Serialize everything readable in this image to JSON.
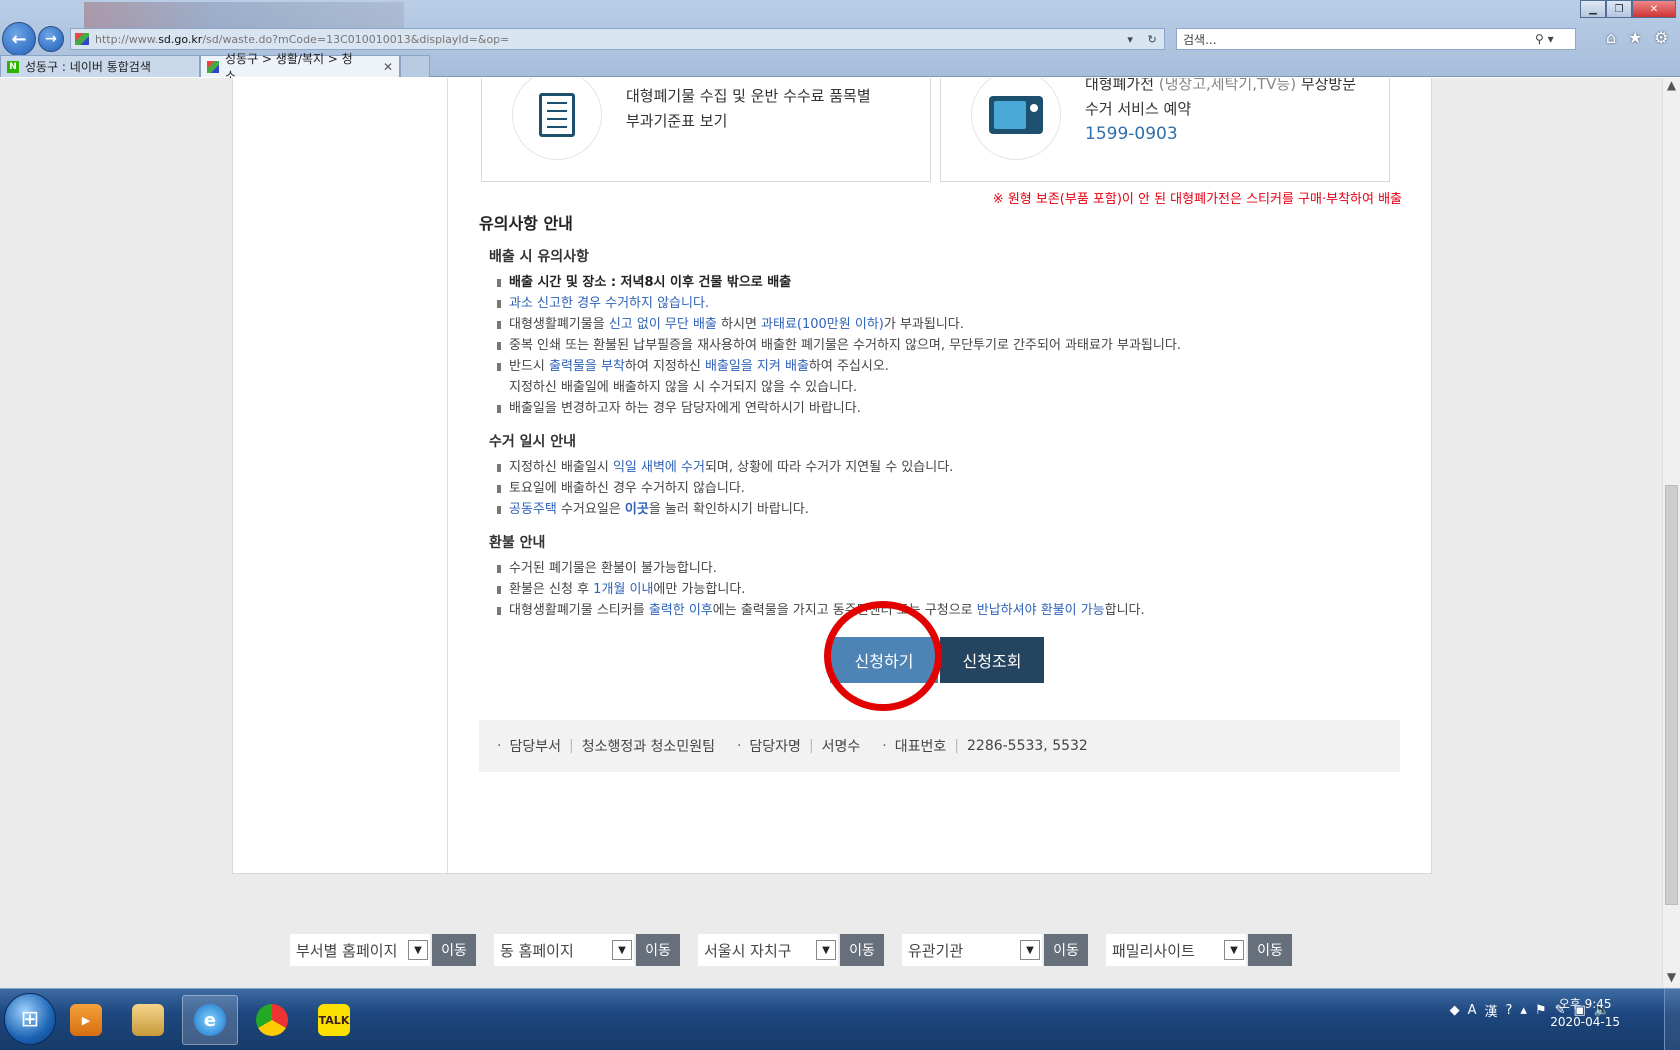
{
  "browser": {
    "url_prefix": "http://www.",
    "url_domain": "sd.go.kr",
    "url_path": "/sd/waste.do?mCode=13C010010013&displayId=&op=",
    "search_placeholder": "검색...",
    "tabs": [
      {
        "label": "성동구 : 네이버 통합검색"
      },
      {
        "label": "성동구 > 생활/복지 > 청소..."
      }
    ]
  },
  "cards": {
    "fee": {
      "line1": "대형폐기물 수집 및 운반 수수료 품목별",
      "line2": "부과기준표 보기"
    },
    "appliance": {
      "line1_a": "대형폐가전 ",
      "line1_b": "(냉장고,세탁기,TV등)",
      "line1_c": " 무상방문",
      "line2": "수거 서비스 예약",
      "phone": "1599-0903"
    }
  },
  "notice_red": "※ 원형 보존(부품 포함)이 안 된 대형폐가전은 스티커를 구매·부착하여 배출",
  "cautions": {
    "title": "유의사항 안내",
    "discharge": {
      "title": "배출 시 유의사항",
      "i1": "배출 시간 및 장소 : 저녁8시 이후 건물 밖으로 배출",
      "i2": "과소 신고한 경우 수거하지 않습니다.",
      "i3_a": "대형생활폐기물을 ",
      "i3_b": "신고 없이 무단 배출",
      "i3_c": " 하시면 ",
      "i3_d": "과태료(100만원 이하)",
      "i3_e": "가 부과됩니다.",
      "i4": "중복 인쇄 또는 환불된 납부필증을 재사용하여 배출한 폐기물은 수거하지 않으며, 무단투기로 간주되어 과태료가 부과됩니다.",
      "i5_a": "반드시 ",
      "i5_b": "출력물을 부착",
      "i5_c": "하여 지정하신 ",
      "i5_d": "배출일을 지켜 배출",
      "i5_e": "하여 주십시오.",
      "i5_line2": "지정하신 배출일에 배출하지 않을 시 수거되지 않을 수 있습니다.",
      "i6": "배출일을 변경하고자 하는 경우 담당자에게 연락하시기 바랍니다."
    },
    "collection": {
      "title": "수거 일시 안내",
      "i1_a": "지정하신 배출일시 ",
      "i1_b": "익일 새벽에 수거",
      "i1_c": "되며, 상황에 따라 수거가 지연될 수 있습니다.",
      "i2": "토요일에 배출하신 경우 수거하지 않습니다.",
      "i3_a": "공동주택",
      "i3_b": " 수거요일은 ",
      "i3_c": "이곳",
      "i3_d": "을 눌러 확인하시기 바랍니다."
    },
    "refund": {
      "title": "환불 안내",
      "i1": "수거된 폐기물은 환불이 불가능합니다.",
      "i2_a": "환불은 신청 후 ",
      "i2_b": "1개월 이내",
      "i2_c": "에만 가능합니다.",
      "i3_a": "대형생활폐기물 스티커를 ",
      "i3_b": "출력한 이후",
      "i3_c": "에는 출력물을 가지고 동주민센터 또는 구청으로 ",
      "i3_d": "반납하셔야 환불이 가능",
      "i3_e": "합니다."
    }
  },
  "buttons": {
    "apply": "신청하기",
    "inquiry": "신청조회"
  },
  "contact": {
    "dept_label": "담당부서",
    "dept_value": "청소행정과 청소민원팀",
    "person_label": "담당자명",
    "person_value": "서명수",
    "phone_label": "대표번호",
    "phone_value": "2286-5533, 5532"
  },
  "footer_links": [
    {
      "label": "부서별 홈페이지",
      "go": "이동"
    },
    {
      "label": "동 홈페이지",
      "go": "이동"
    },
    {
      "label": "서울시 자치구",
      "go": "이동"
    },
    {
      "label": "유관기관",
      "go": "이동"
    },
    {
      "label": "패밀리사이트",
      "go": "이동"
    }
  ],
  "taskbar": {
    "kakao_label": "TALK",
    "ime_a": "A",
    "ime_b": "漢",
    "clock_time": "오후 9:45",
    "clock_date": "2020-04-15"
  },
  "colors": {
    "accent_blue": "#4d84b5",
    "dark_navy": "#254460",
    "link_blue": "#2f62b8",
    "warning_red": "#e60012"
  }
}
